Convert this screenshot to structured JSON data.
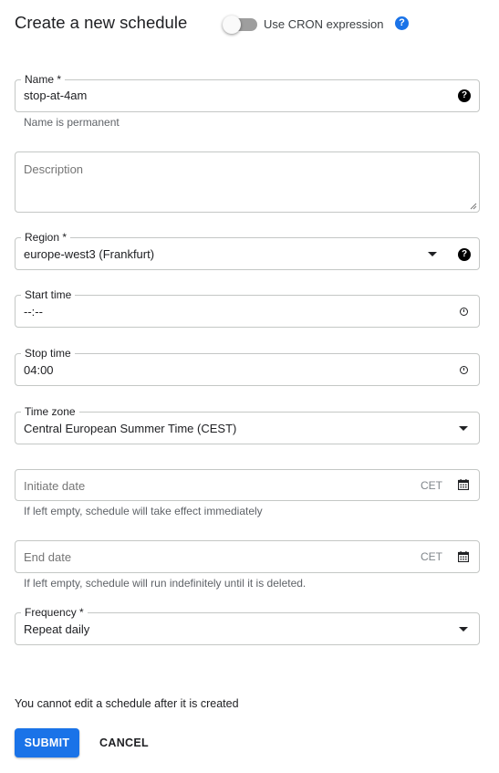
{
  "header": {
    "title": "Create a new schedule",
    "cron_toggle_label": "Use CRON expression",
    "cron_toggle_on": false,
    "help_glyph": "?"
  },
  "form": {
    "name": {
      "label": "Name *",
      "value": "stop-at-4am",
      "hint": "Name is permanent",
      "help_glyph": "?"
    },
    "description": {
      "placeholder": "Description",
      "value": ""
    },
    "region": {
      "label": "Region *",
      "value": "europe-west3 (Frankfurt)",
      "help_glyph": "?"
    },
    "start_time": {
      "label": "Start time",
      "value": "--:--"
    },
    "stop_time": {
      "label": "Stop time",
      "value": "04:00"
    },
    "time_zone": {
      "label": "Time zone",
      "value": "Central European Summer Time (CEST)"
    },
    "initiate_date": {
      "placeholder": "Initiate date",
      "suffix": "CET",
      "hint": "If left empty, schedule will take effect immediately"
    },
    "end_date": {
      "placeholder": "End date",
      "suffix": "CET",
      "hint": "If left empty, schedule will run indefinitely until it is deleted."
    },
    "frequency": {
      "label": "Frequency *",
      "value": "Repeat daily"
    }
  },
  "footer": {
    "note": "You cannot edit a schedule after it is created",
    "submit_label": "SUBMIT",
    "cancel_label": "CANCEL"
  },
  "icons": {
    "help_blue": "help-circle-icon",
    "help_black": "help-circle-icon",
    "dropdown": "caret-down-icon",
    "clock": "clock-icon",
    "calendar": "calendar-icon"
  },
  "colors": {
    "accent": "#1a73e8",
    "border": "#c4c7c5",
    "text": "#202124",
    "hint": "#5f6368"
  }
}
